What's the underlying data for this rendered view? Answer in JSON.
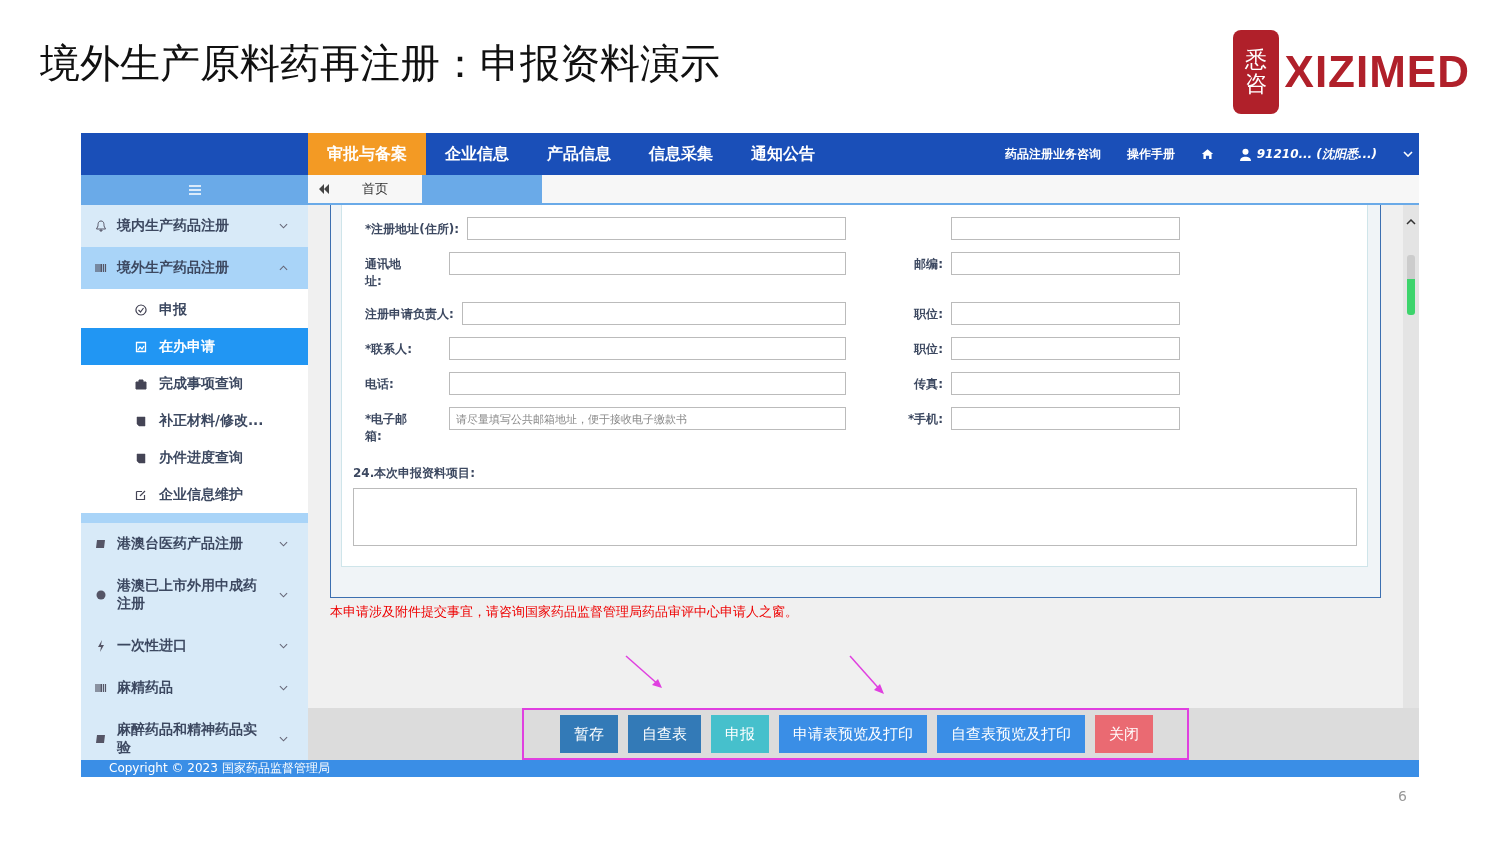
{
  "slide": {
    "title": "境外生产原料药再注册：申报资料演示",
    "logo_seal": "悉咨",
    "logo_text": "XIZIMED",
    "page_number": "6"
  },
  "header": {
    "nav": [
      {
        "label": "审批与备案",
        "selected": true
      },
      {
        "label": "企业信息",
        "selected": false
      },
      {
        "label": "产品信息",
        "selected": false
      },
      {
        "label": "信息采集",
        "selected": false
      },
      {
        "label": "通知公告",
        "selected": false
      }
    ],
    "links": [
      {
        "kind": "text",
        "label": "药品注册业务咨询"
      },
      {
        "kind": "text",
        "label": "操作手册"
      },
      {
        "kind": "home"
      },
      {
        "kind": "user",
        "label": "91210... (沈阳悉...)"
      }
    ]
  },
  "tabs": [
    {
      "label": "首页",
      "selected": false
    },
    {
      "selected": true
    }
  ],
  "sidebar": {
    "items": [
      {
        "label": "境内生产药品注册",
        "expanded": false
      },
      {
        "label": "境外生产药品注册",
        "expanded": true,
        "children": [
          {
            "label": "申报",
            "selected": false
          },
          {
            "label": "在办申请",
            "selected": true
          },
          {
            "label": "完成事项查询",
            "selected": false
          },
          {
            "label": "补正材料/修改...",
            "selected": false
          },
          {
            "label": "办件进度查询",
            "selected": false
          },
          {
            "label": "企业信息维护",
            "selected": false
          }
        ]
      },
      {
        "label": "港澳台医药产品注册",
        "expanded": false
      },
      {
        "label": "港澳已上市外用中成药注册",
        "expanded": false
      },
      {
        "label": "一次性进口",
        "expanded": false
      },
      {
        "label": "麻精药品",
        "expanded": false
      },
      {
        "label": "麻醉药品和精神药品实验",
        "expanded": false
      }
    ]
  },
  "form": {
    "rows": [
      {
        "left": {
          "label": "*注册地址(住所):"
        },
        "right": {}
      },
      {
        "left": {
          "label": "通讯地址:"
        },
        "right": {
          "label": "邮编:"
        }
      },
      {
        "left": {
          "label": "注册申请负责人:"
        },
        "right": {
          "label": "职位:"
        }
      },
      {
        "left": {
          "label": "*联系人:"
        },
        "right": {
          "label": "职位:"
        }
      },
      {
        "left": {
          "label": "电话:"
        },
        "right": {
          "label": "传真:"
        }
      },
      {
        "left": {
          "label": "*电子邮箱:",
          "placeholder": "请尽量填写公共邮箱地址，便于接收电子缴款书"
        },
        "right": {
          "label": "*手机:"
        }
      }
    ],
    "section_label": "24.本次申报资料项目:"
  },
  "notice": "本申请涉及附件提交事宜，请咨询国家药品监督管理局药品审评中心申请人之窗。",
  "buttons": [
    {
      "label": "暂存",
      "color": "#337ab7"
    },
    {
      "label": "自查表",
      "color": "#337ab7"
    },
    {
      "label": "申报",
      "color": "#46c0cc"
    },
    {
      "label": "申请表预览及打印",
      "color": "#3a8ee6"
    },
    {
      "label": "自查表预览及打印",
      "color": "#3a8ee6"
    },
    {
      "label": "关闭",
      "color": "#ea6a72"
    }
  ],
  "footer": "Copyright © 2023 国家药品监督管理局"
}
